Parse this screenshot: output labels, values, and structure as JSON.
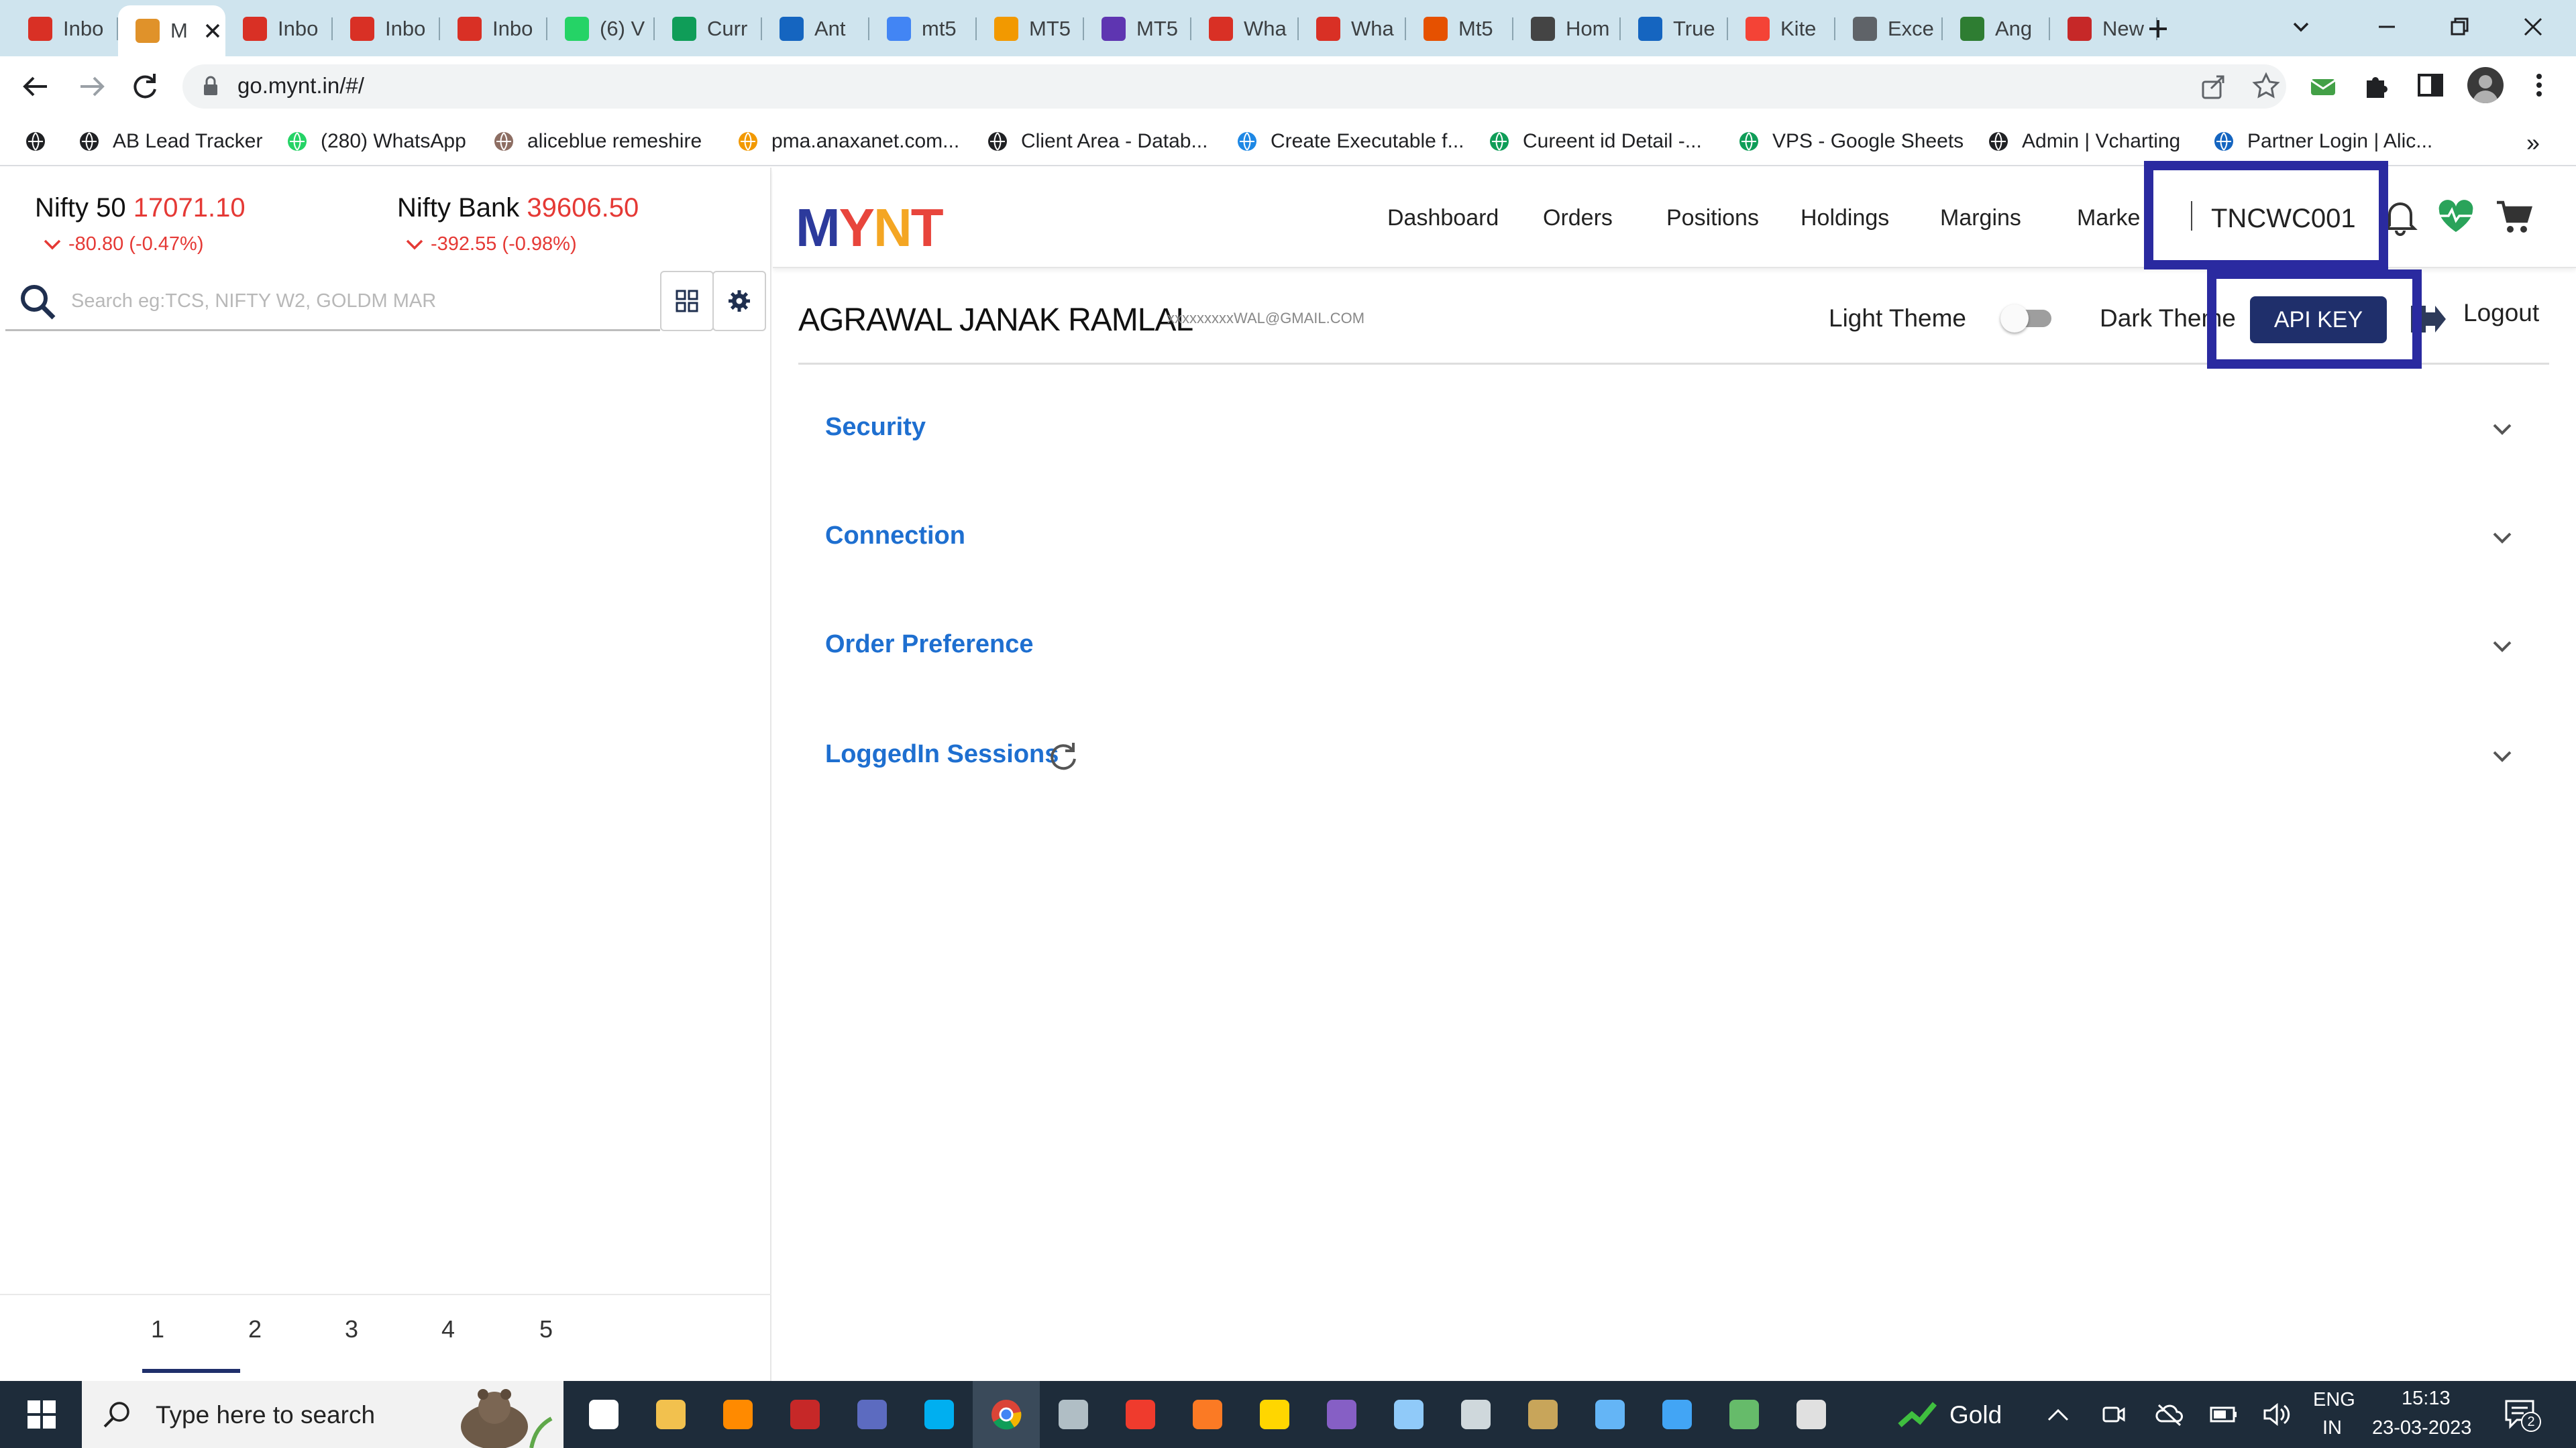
{
  "browser": {
    "tabs": [
      {
        "label": "Inbo",
        "icon": "gmail-icon",
        "color": "#d93025",
        "active": false
      },
      {
        "label": "M",
        "icon": "mynt-icon",
        "color": "#e0922a",
        "active": true
      },
      {
        "label": "Inbo",
        "icon": "gmail-icon",
        "color": "#d93025",
        "active": false
      },
      {
        "label": "Inbo",
        "icon": "gmail-icon",
        "color": "#d93025",
        "active": false
      },
      {
        "label": "Inbo",
        "icon": "gmail-icon",
        "color": "#d93025",
        "active": false
      },
      {
        "label": "(6) V",
        "icon": "whatsapp-icon",
        "color": "#25d366",
        "active": false
      },
      {
        "label": "Curr",
        "icon": "sheets-icon",
        "color": "#0f9d58",
        "active": false
      },
      {
        "label": "Ant",
        "icon": "ant-icon",
        "color": "#1565c0",
        "active": false
      },
      {
        "label": "mt5",
        "icon": "google-icon",
        "color": "#4285f4",
        "active": false
      },
      {
        "label": "MT5",
        "icon": "mt5-icon",
        "color": "#f29900",
        "active": false
      },
      {
        "label": "MT5",
        "icon": "mt5-icon",
        "color": "#5e35b1",
        "active": false
      },
      {
        "label": "Wha",
        "icon": "alert-icon",
        "color": "#d93025",
        "active": false
      },
      {
        "label": "Wha",
        "icon": "alert-icon",
        "color": "#d93025",
        "active": false
      },
      {
        "label": "Mt5",
        "icon": "mt5-icon",
        "color": "#e65100",
        "active": false
      },
      {
        "label": "Hom",
        "icon": "mynt-icon",
        "color": "#444444",
        "active": false
      },
      {
        "label": "True",
        "icon": "tc-icon",
        "color": "#1565c0",
        "active": false
      },
      {
        "label": "Kite",
        "icon": "kite-icon",
        "color": "#f44336",
        "active": false
      },
      {
        "label": "Exce",
        "icon": "globe-icon",
        "color": "#5f6368",
        "active": false
      },
      {
        "label": "Ang",
        "icon": "angel-icon",
        "color": "#2e7d32",
        "active": false
      },
      {
        "label": "New",
        "icon": "toi-icon",
        "color": "#c62828",
        "active": false
      }
    ],
    "url": "go.mynt.in/#/",
    "bookmarks": [
      {
        "label": "",
        "icon": "globe-icon"
      },
      {
        "label": "AB Lead Tracker",
        "icon": "globe-icon"
      },
      {
        "label": "(280) WhatsApp",
        "icon": "whatsapp-icon"
      },
      {
        "label": "aliceblue remeshire",
        "icon": "image-icon"
      },
      {
        "label": "pma.anaxanet.com...",
        "icon": "pma-icon"
      },
      {
        "label": "Client Area - Datab...",
        "icon": "globe-icon"
      },
      {
        "label": "Create Executable f...",
        "icon": "fish-icon"
      },
      {
        "label": "Cureent id Detail -...",
        "icon": "sheets-icon"
      },
      {
        "label": "VPS - Google Sheets",
        "icon": "sheets-icon"
      },
      {
        "label": "Admin | Vcharting",
        "icon": "globe-icon"
      },
      {
        "label": "Partner Login | Alic...",
        "icon": "partner-icon"
      }
    ]
  },
  "indices": [
    {
      "name": "Nifty 50",
      "value": "17071.10",
      "change": "-80.80 (-0.47%)"
    },
    {
      "name": "Nifty Bank",
      "value": "39606.50",
      "change": "-392.55 (-0.98%)"
    }
  ],
  "search": {
    "placeholder": "Search eg:TCS, NIFTY W2, GOLDM MAR"
  },
  "brand": {
    "logo": "MYNT"
  },
  "nav": [
    "Dashboard",
    "Orders",
    "Positions",
    "Holdings",
    "Margins",
    "Marke"
  ],
  "client_id": "TNCWC001",
  "profile": {
    "name": "AGRAWAL JANAK RAMLAL",
    "email": "xxxxxxxxxWAL@GMAIL.COM",
    "light_theme": "Light Theme",
    "dark_theme": "Dark Theme",
    "api_key": "API KEY",
    "logout": "Logout"
  },
  "sections": [
    {
      "label": "Security"
    },
    {
      "label": "Connection"
    },
    {
      "label": "Order Preference"
    },
    {
      "label": "LoggedIn Sessions"
    }
  ],
  "pagination": [
    "1",
    "2",
    "3",
    "4",
    "5"
  ],
  "taskbar": {
    "search_placeholder": "Type here to search",
    "weather": "Gold",
    "lang": "ENG",
    "region": "IN",
    "time": "15:13",
    "date": "23-03-2023",
    "notifications": "2"
  },
  "colors": {
    "accent_blue": "#1e6fd0",
    "negative": "#e53935",
    "api_button": "#1f2f6b",
    "highlight": "#2a2aa0",
    "taskbar": "#1e2c3a"
  }
}
